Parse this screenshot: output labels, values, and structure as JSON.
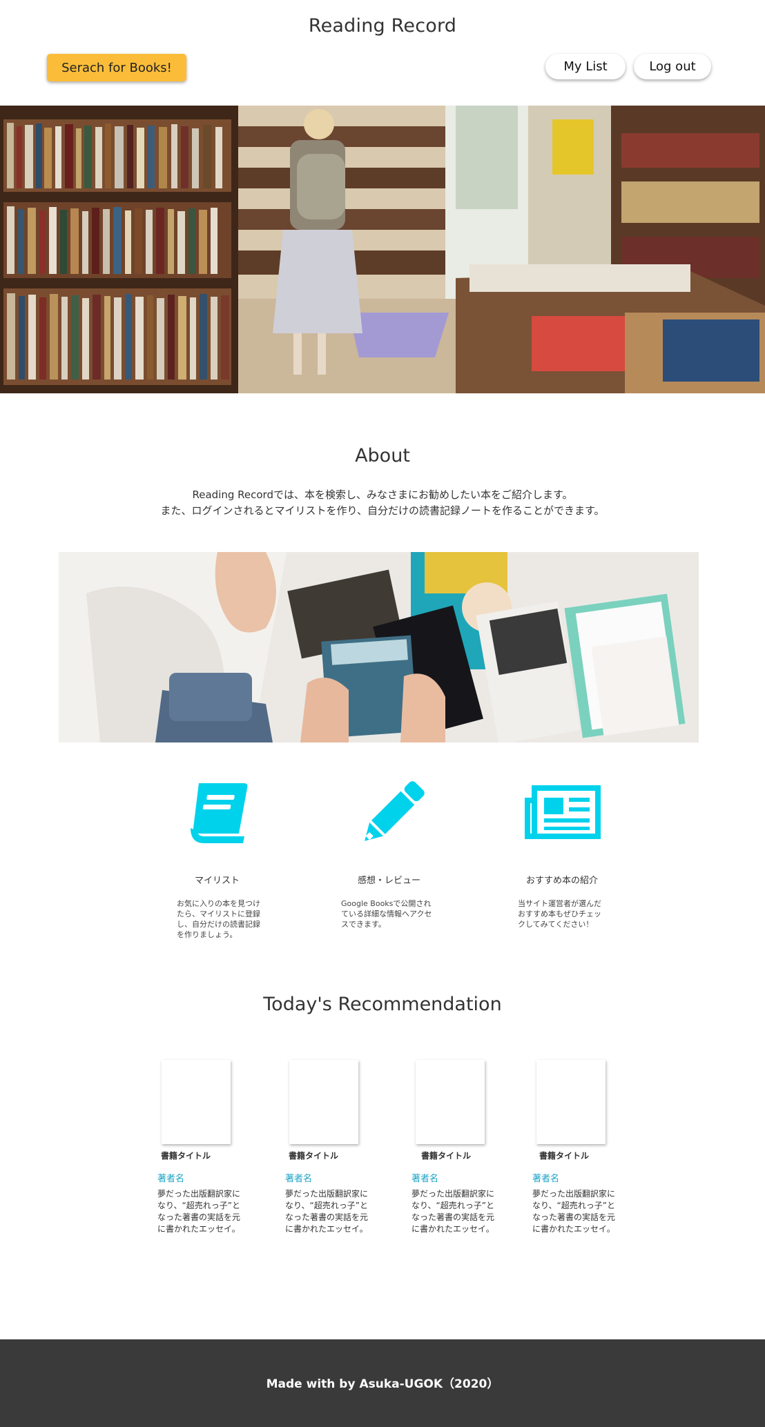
{
  "header": {
    "site_title": "Reading Record",
    "search_button": "Serach for Books!",
    "my_list_button": "My List",
    "logout_button": "Log out"
  },
  "about": {
    "title": "About",
    "line1": "Reading Recordでは、本を検索し、みなさまにお勧めしたい本をご紹介します。",
    "line2": "また、ログインされるとマイリストを作り、自分だけの読書記録ノートを作ることができます。"
  },
  "features": [
    {
      "icon": "book-icon",
      "title": "マイリスト",
      "desc": "お気に入りの本を見つけたら、マイリストに登録し、自分だけの読書記録を作りましょう。"
    },
    {
      "icon": "pencil-icon",
      "title": "感想・レビュー",
      "desc": "Google Booksで公開されている詳細な情報へアクセスできます。"
    },
    {
      "icon": "newspaper-icon",
      "title": "おすすめ本の紹介",
      "desc": "当サイト運営者が選んだおすすめ本もぜひチェックしてみてください！"
    }
  ],
  "recommendation": {
    "title": "Today's Recommendation",
    "cards": [
      {
        "book_title": "書籍タイトル",
        "author": "著者名",
        "desc": "夢だった出版翻訳家になり、“超売れっ子”となった著書の実話を元に書かれたエッセイ。"
      },
      {
        "book_title": "書籍タイトル",
        "author": "著者名",
        "desc": "夢だった出版翻訳家になり、“超売れっ子”となった著書の実話を元に書かれたエッセイ。"
      },
      {
        "book_title": "書籍タイトル",
        "author": "著者名",
        "desc": "夢だった出版翻訳家になり、“超売れっ子”となった著書の実話を元に書かれたエッセイ。"
      },
      {
        "book_title": "書籍タイトル",
        "author": "著者名",
        "desc": "夢だった出版翻訳家になり、“超売れっ子”となった著書の実話を元に書かれたエッセイ。"
      }
    ]
  },
  "footer": {
    "text": "Made with by Asuka-UGOK（2020）"
  },
  "colors": {
    "accent": "#00d2ec",
    "search_button": "#fbbd39",
    "author_link": "#1aa3c4",
    "footer_bg": "#3b3a3a"
  }
}
